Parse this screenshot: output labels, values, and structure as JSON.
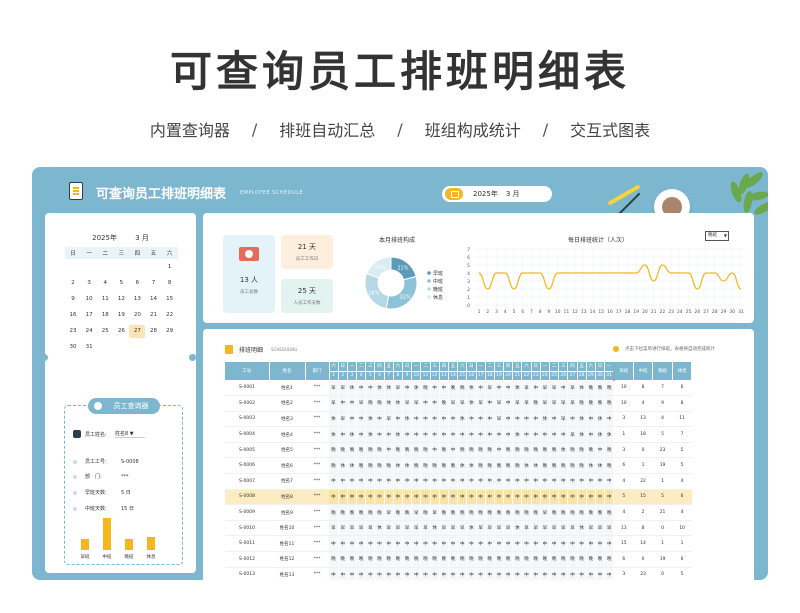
{
  "hero": {
    "title": "可查询员工排班明细表",
    "subtitles": [
      "内置查询器",
      "排班自动汇总",
      "班组构成统计",
      "交互式图表"
    ],
    "separator": "/"
  },
  "app": {
    "title": "可查询员工排班明细表",
    "subtitle": "EMPLOYEE SCHEDULE",
    "year": "2025年",
    "month": "3 月"
  },
  "calendar": {
    "year": "2025年",
    "month": "3 月",
    "weekdays": [
      "日",
      "一",
      "二",
      "三",
      "四",
      "五",
      "六"
    ],
    "weeks": [
      [
        "",
        "",
        "",
        "",
        "",
        "",
        "1"
      ],
      [
        "2",
        "3",
        "4",
        "5",
        "6",
        "7",
        "8"
      ],
      [
        "9",
        "10",
        "11",
        "12",
        "13",
        "14",
        "15"
      ],
      [
        "16",
        "17",
        "18",
        "19",
        "20",
        "21",
        "22"
      ],
      [
        "23",
        "24",
        "25",
        "26",
        "27",
        "28",
        "29"
      ],
      [
        "30",
        "31",
        "",
        "",
        "",
        "",
        ""
      ]
    ],
    "today": "27"
  },
  "query": {
    "title": "员工查询器",
    "name_label": "员工姓名:",
    "name_value": "姓名8",
    "id_label": "员工工号:",
    "id_value": "S-0008",
    "dept_label": "部　门:",
    "dept_value": "***",
    "early_label": "早班天数:",
    "early_value": "5 日",
    "mid_label": "中班天数:",
    "mid_value": "15 日",
    "bars": [
      {
        "label": "早班",
        "value": 5
      },
      {
        "label": "中班",
        "value": 15
      },
      {
        "label": "晚班",
        "value": 5
      },
      {
        "label": "休息",
        "value": 6
      }
    ]
  },
  "kpis": {
    "employees": "13 人",
    "employees_cap": "员工总数",
    "workdays": "21 天",
    "workdays_cap": "员工工作日",
    "shiftdays": "25 天",
    "shiftdays_cap": "人员工作天数"
  },
  "colors": {
    "primary": "#7cb7cf",
    "accent": "#f3b81e",
    "highlight": "#fdecc2"
  },
  "chart_data": [
    {
      "type": "pie",
      "title": "本月排班构成",
      "categories": [
        "早班",
        "中班",
        "晚班",
        "休息"
      ],
      "values": [
        21,
        32,
        28,
        19
      ],
      "labels": [
        "21%",
        "32%",
        "28%",
        "19%"
      ],
      "colors": [
        "#5b9ab8",
        "#8cc3d8",
        "#b4d8e6",
        "#d9ecf3"
      ]
    },
    {
      "type": "line",
      "title": "每日排班统计（人次）",
      "selector": "晚班",
      "x": [
        1,
        2,
        3,
        4,
        5,
        6,
        7,
        8,
        9,
        10,
        11,
        12,
        13,
        14,
        15,
        16,
        17,
        18,
        19,
        20,
        21,
        22,
        23,
        24,
        25,
        26,
        27,
        28,
        29,
        30,
        31
      ],
      "values": [
        4,
        2,
        4,
        4,
        2,
        4,
        4,
        4,
        2,
        4,
        4,
        4,
        4,
        4,
        4,
        4,
        4,
        4,
        4,
        5,
        3,
        5,
        4,
        4,
        4,
        2,
        4,
        4,
        3,
        4,
        2
      ],
      "ylim": [
        0,
        7
      ],
      "yticks": [
        "0",
        "1",
        "2",
        "3",
        "4",
        "5",
        "6",
        "7"
      ]
    }
  ],
  "table": {
    "title": "排班明细",
    "title_en": "SCHEDULING",
    "hint": "点击下拉菜单进行排班，表格将自动完成统计",
    "headers": {
      "id": "工号",
      "name": "姓名",
      "dept": "部门",
      "early": "早班",
      "mid": "中班",
      "night": "晚班",
      "rest": "休息"
    },
    "weekday_row": [
      "六",
      "日",
      "一",
      "二",
      "三",
      "四",
      "五",
      "六",
      "日",
      "一",
      "二",
      "三",
      "四",
      "五",
      "六",
      "日",
      "一",
      "二",
      "三",
      "四",
      "五",
      "六",
      "日",
      "一",
      "二",
      "三",
      "四",
      "五",
      "六",
      "日",
      "一"
    ],
    "day_row": [
      "1",
      "2",
      "3",
      "4",
      "5",
      "6",
      "7",
      "8",
      "9",
      "10",
      "11",
      "12",
      "13",
      "14",
      "15",
      "16",
      "17",
      "18",
      "19",
      "20",
      "21",
      "22",
      "23",
      "24",
      "25",
      "26",
      "27",
      "28",
      "29",
      "30",
      "31"
    ],
    "rows": [
      {
        "id": "S-0001",
        "name": "姓名1",
        "dept": "***",
        "days": [
          "早",
          "早",
          "休",
          "中",
          "中",
          "休",
          "休",
          "早",
          "中",
          "休",
          "晚",
          "中",
          "中",
          "晚",
          "晚",
          "休",
          "中",
          "早",
          "中",
          "中",
          "休",
          "早",
          "中",
          "早",
          "早",
          "中",
          "早",
          "休",
          "晚",
          "晚",
          "晚"
        ],
        "early": "10",
        "mid": "8",
        "night": "7",
        "rest": "6"
      },
      {
        "id": "S-0002",
        "name": "姓名2",
        "dept": "***",
        "days": [
          "早",
          "中",
          "中",
          "早",
          "晚",
          "晚",
          "休",
          "休",
          "早",
          "早",
          "中",
          "中",
          "晚",
          "早",
          "早",
          "休",
          "早",
          "中",
          "早",
          "中",
          "早",
          "早",
          "晚",
          "早",
          "早",
          "早",
          "早",
          "晚",
          "晚",
          "晚",
          "晚"
        ],
        "early": "10",
        "mid": "4",
        "night": "9",
        "rest": "8"
      },
      {
        "id": "S-0003",
        "name": "姓名3",
        "dept": "***",
        "days": [
          "休",
          "早",
          "中",
          "中",
          "休",
          "中",
          "早",
          "中",
          "休",
          "中",
          "中",
          "中",
          "中",
          "中",
          "休",
          "中",
          "中",
          "中",
          "早",
          "中",
          "中",
          "中",
          "中",
          "休",
          "中",
          "早",
          "中",
          "休",
          "中",
          "休",
          "中"
        ],
        "early": "3",
        "mid": "13",
        "night": "4",
        "rest": "11"
      },
      {
        "id": "S-0004",
        "name": "姓名4",
        "dept": "***",
        "days": [
          "休",
          "中",
          "休",
          "中",
          "休",
          "中",
          "中",
          "休",
          "中",
          "中",
          "中",
          "中",
          "中",
          "中",
          "中",
          "中",
          "中",
          "中",
          "中",
          "中",
          "休",
          "中",
          "中",
          "中",
          "中",
          "中",
          "早",
          "休",
          "中",
          "休",
          "休"
        ],
        "early": "1",
        "mid": "18",
        "night": "5",
        "rest": "7"
      },
      {
        "id": "S-0005",
        "name": "姓名5",
        "dept": "***",
        "days": [
          "晚",
          "晚",
          "晚",
          "晚",
          "晚",
          "晚",
          "中",
          "晚",
          "晚",
          "晚",
          "晚",
          "中",
          "晚",
          "中",
          "晚",
          "晚",
          "晚",
          "晚",
          "中",
          "晚",
          "晚",
          "晚",
          "晚",
          "晚",
          "晚",
          "休",
          "晚",
          "晚",
          "晚",
          "中",
          "晚"
        ],
        "early": "3",
        "mid": "0",
        "night": "23",
        "rest": "5"
      },
      {
        "id": "S-0006",
        "name": "姓名6",
        "dept": "***",
        "days": [
          "晚",
          "休",
          "休",
          "晚",
          "晚",
          "晚",
          "晚",
          "休",
          "休",
          "晚",
          "晚",
          "晚",
          "晚",
          "晚",
          "休",
          "休",
          "晚",
          "晚",
          "晚",
          "晚",
          "晚",
          "休",
          "休",
          "晚",
          "晚",
          "晚",
          "晚",
          "晚",
          "休",
          "休",
          "晚"
        ],
        "early": "6",
        "mid": "1",
        "night": "19",
        "rest": "5"
      },
      {
        "id": "S-0007",
        "name": "姓名7",
        "dept": "***",
        "days": [
          "中",
          "中",
          "中",
          "中",
          "中",
          "中",
          "中",
          "中",
          "中",
          "中",
          "中",
          "中",
          "中",
          "中",
          "中",
          "中",
          "中",
          "中",
          "中",
          "中",
          "中",
          "中",
          "中",
          "中",
          "中",
          "中",
          "中",
          "中",
          "中",
          "中",
          "中"
        ],
        "early": "4",
        "mid": "22",
        "night": "1",
        "rest": "4"
      },
      {
        "id": "S-0008",
        "name": "姓名8",
        "dept": "***",
        "days": [
          "中",
          "中",
          "中",
          "中",
          "中",
          "中",
          "中",
          "中",
          "中",
          "中",
          "中",
          "中",
          "中",
          "中",
          "中",
          "中",
          "中",
          "中",
          "中",
          "中",
          "中",
          "中",
          "中",
          "中",
          "中",
          "中",
          "中",
          "中",
          "中",
          "中",
          "中"
        ],
        "early": "5",
        "mid": "15",
        "night": "5",
        "rest": "6"
      },
      {
        "id": "S-0009",
        "name": "姓名9",
        "dept": "***",
        "days": [
          "晚",
          "晚",
          "晚",
          "晚",
          "晚",
          "晚",
          "早",
          "晚",
          "晚",
          "早",
          "晚",
          "早",
          "晚",
          "晚",
          "晚",
          "晚",
          "晚",
          "晚",
          "晚",
          "晚",
          "晚",
          "晚",
          "晚",
          "早",
          "晚",
          "晚",
          "晚",
          "晚",
          "晚",
          "晚",
          "晚"
        ],
        "early": "4",
        "mid": "2",
        "night": "21",
        "rest": "4"
      },
      {
        "id": "S-0010",
        "name": "姓名10",
        "dept": "***",
        "days": [
          "早",
          "早",
          "早",
          "早",
          "早",
          "休",
          "早",
          "早",
          "早",
          "早",
          "早",
          "休",
          "早",
          "早",
          "早",
          "休",
          "早",
          "早",
          "早",
          "早",
          "休",
          "早",
          "早",
          "早",
          "早",
          "早",
          "早",
          "休",
          "早",
          "早",
          "早"
        ],
        "early": "13",
        "mid": "8",
        "night": "0",
        "rest": "10"
      },
      {
        "id": "S-0011",
        "name": "姓名11",
        "dept": "***",
        "days": [
          "中",
          "中",
          "中",
          "中",
          "中",
          "中",
          "中",
          "中",
          "中",
          "中",
          "中",
          "中",
          "中",
          "中",
          "中",
          "中",
          "中",
          "中",
          "中",
          "中",
          "中",
          "中",
          "中",
          "中",
          "中",
          "中",
          "中",
          "中",
          "中",
          "中",
          "中"
        ],
        "early": "15",
        "mid": "14",
        "night": "1",
        "rest": "1"
      },
      {
        "id": "S-0012",
        "name": "姓名12",
        "dept": "***",
        "days": [
          "晚",
          "晚",
          "晚",
          "晚",
          "晚",
          "晚",
          "晚",
          "晚",
          "晚",
          "晚",
          "晚",
          "晚",
          "晚",
          "晚",
          "晚",
          "晚",
          "晚",
          "晚",
          "晚",
          "晚",
          "晚",
          "晚",
          "晚",
          "晚",
          "晚",
          "晚",
          "晚",
          "晚",
          "晚",
          "晚",
          "晚"
        ],
        "early": "6",
        "mid": "0",
        "night": "19",
        "rest": "6"
      },
      {
        "id": "S-0013",
        "name": "姓名13",
        "dept": "***",
        "days": [
          "中",
          "中",
          "中",
          "中",
          "中",
          "中",
          "中",
          "中",
          "中",
          "中",
          "中",
          "中",
          "中",
          "中",
          "中",
          "中",
          "中",
          "中",
          "中",
          "中",
          "中",
          "中",
          "中",
          "中",
          "中",
          "中",
          "中",
          "中",
          "中",
          "中",
          "中"
        ],
        "early": "3",
        "mid": "23",
        "night": "0",
        "rest": "5"
      }
    ],
    "highlight_row": "S-0008"
  }
}
